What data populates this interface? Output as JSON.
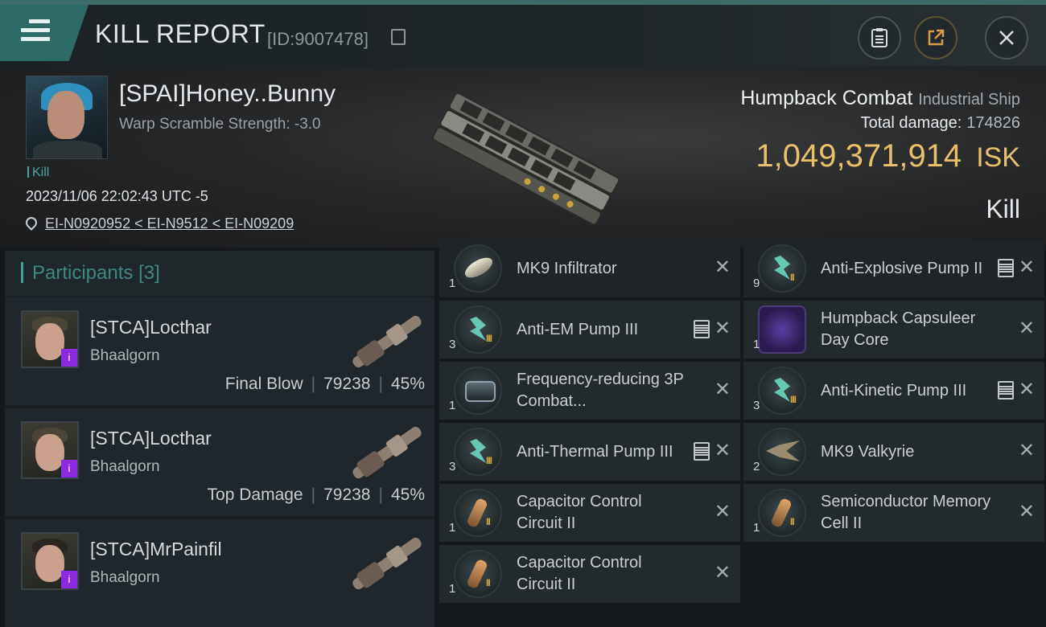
{
  "header": {
    "title": "KILL REPORT",
    "report_id": "[ID:9007478]"
  },
  "victim": {
    "name": "[SPAI]Honey..Bunny",
    "warp_scramble": "Warp Scramble Strength: -3.0",
    "kill_tag": "Kill",
    "datetime": "2023/11/06 22:02:43 UTC -5",
    "location": "EI-N0920952 < EI-N9512 < EI-N09209",
    "ship_name": "Humpback Combat",
    "ship_class": "Industrial Ship",
    "total_damage_label": "Total damage:",
    "total_damage": "174826",
    "isk_value": "1,049,371,914",
    "isk_unit": "ISK",
    "result": "Kill"
  },
  "participants": {
    "title": "Participants",
    "count": "[3]",
    "items": [
      {
        "name": "[STCA]Locthar",
        "corp": "Bhaalgorn",
        "role": "Final Blow",
        "damage": "79238",
        "percent": "45%"
      },
      {
        "name": "[STCA]Locthar",
        "corp": "Bhaalgorn",
        "role": "Top Damage",
        "damage": "79238",
        "percent": "45%"
      },
      {
        "name": "[STCA]MrPainfil",
        "corp": "Bhaalgorn"
      }
    ]
  },
  "modules": {
    "left": [
      {
        "name": "MK9  Infiltrator",
        "qty": "1",
        "tier": "",
        "icon": "drone-icon",
        "stack": false
      },
      {
        "name": "Anti-EM Pump III",
        "qty": "3",
        "tier": "III",
        "icon": "pump-icon",
        "stack": true
      },
      {
        "name": "Frequency-reducing 3P Combat...",
        "qty": "1",
        "tier": "",
        "icon": "scope-icon",
        "stack": false
      },
      {
        "name": "Anti-Thermal Pump III",
        "qty": "3",
        "tier": "III",
        "icon": "pump-icon",
        "stack": true
      },
      {
        "name": "Capacitor Control Circuit II",
        "qty": "1",
        "tier": "II",
        "icon": "circuit-icon",
        "stack": false
      },
      {
        "name": "Capacitor Control Circuit II",
        "qty": "1",
        "tier": "II",
        "icon": "circuit-icon",
        "stack": false
      }
    ],
    "right": [
      {
        "name": "Anti-Explosive Pump II",
        "qty": "9",
        "tier": "II",
        "icon": "pump-icon",
        "stack": true
      },
      {
        "name": "Humpback Capsuleer Day Core",
        "qty": "1",
        "tier": "",
        "icon": "core-icon",
        "stack": false
      },
      {
        "name": "Anti-Kinetic Pump III",
        "qty": "3",
        "tier": "III",
        "icon": "pump-icon",
        "stack": true
      },
      {
        "name": "MK9  Valkyrie",
        "qty": "2",
        "tier": "",
        "icon": "valkyrie-icon",
        "stack": false
      },
      {
        "name": "Semiconductor Memory Cell II",
        "qty": "1",
        "tier": "II",
        "icon": "circuit-icon",
        "stack": false
      }
    ]
  },
  "colors": {
    "accent": "#3aa39d",
    "isk": "#e9c06a",
    "badge": "#8a2be2"
  }
}
